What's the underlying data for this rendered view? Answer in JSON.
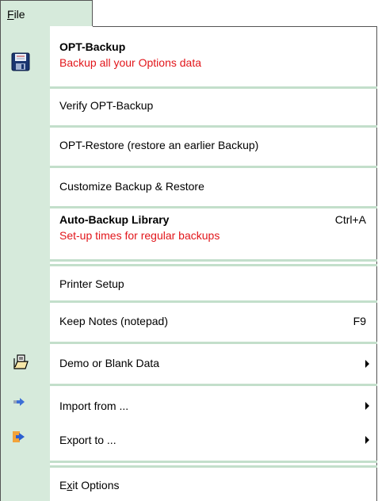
{
  "menubar": {
    "file_pre": "F",
    "file_rest": "ile"
  },
  "menu": {
    "backup": {
      "title": "OPT-Backup",
      "subtitle": "Backup all your Options data"
    },
    "verify": {
      "label": "Verify OPT-Backup"
    },
    "restore": {
      "label": "OPT-Restore  (restore an earlier Backup)"
    },
    "customize": {
      "label": "Customize Backup & Restore"
    },
    "auto_backup": {
      "title": "Auto-Backup Library",
      "subtitle": "Set-up times for regular backups",
      "shortcut": "Ctrl+A"
    },
    "printer": {
      "label": "Printer Setup"
    },
    "notes": {
      "label": "Keep Notes (notepad)",
      "shortcut": "F9"
    },
    "demo": {
      "label": "Demo or Blank Data"
    },
    "import": {
      "label": "Import from ..."
    },
    "export": {
      "label": "Export to ..."
    },
    "exit": {
      "pre": "E",
      "u": "x",
      "rest": "it Options"
    }
  },
  "icons": {
    "backup": "floppy-disk-icon",
    "demo": "open-document-icon",
    "import": "import-arrow-icon",
    "export": "export-arrow-icon"
  },
  "colors": {
    "gutter": "#d6eadb",
    "separator": "#c3dfcb",
    "subtitle": "#e2161b"
  }
}
